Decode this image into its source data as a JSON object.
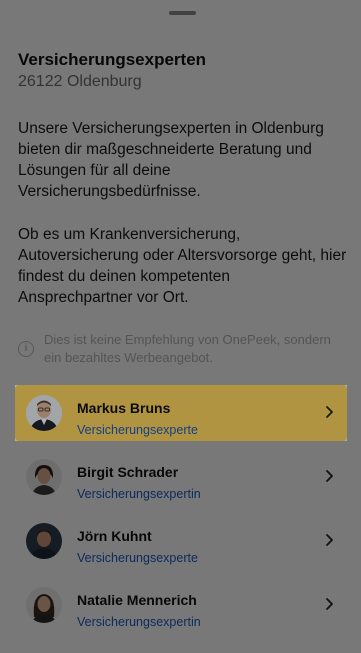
{
  "sheet": {
    "title": "Versicherungsexperten",
    "location": "26122 Oldenburg",
    "paragraph1": "Unsere Versicherungsexperten in Oldenburg bieten dir maßgeschneiderte Beratung und Lösungen für all deine Versicherungsbedürfnisse.",
    "paragraph2": "Ob es um Krankenversicherung, Autoversicherung oder Altersvorsorge geht, hier findest du deinen kompetenten Ansprechpartner vor Ort.",
    "disclaimer": "Dies ist keine Empfehlung von OnePeek, sondern ein bezahltes Werbeangebot."
  },
  "experts": [
    {
      "name": "Markus Bruns",
      "role": "Versicherungsexperte",
      "selected": true
    },
    {
      "name": "Birgit Schrader",
      "role": "Versicherungsexpertin",
      "selected": false
    },
    {
      "name": "Jörn Kuhnt",
      "role": "Versicherungsexperte",
      "selected": false
    },
    {
      "name": "Natalie Mennerich",
      "role": "Versicherungsexpertin",
      "selected": false
    }
  ],
  "colors": {
    "highlight": "#fcd55f",
    "link": "#1b5cc4"
  },
  "icons": {
    "info": "info-icon",
    "chevron": "chevron-right-icon",
    "avatar": "avatar-photo"
  }
}
